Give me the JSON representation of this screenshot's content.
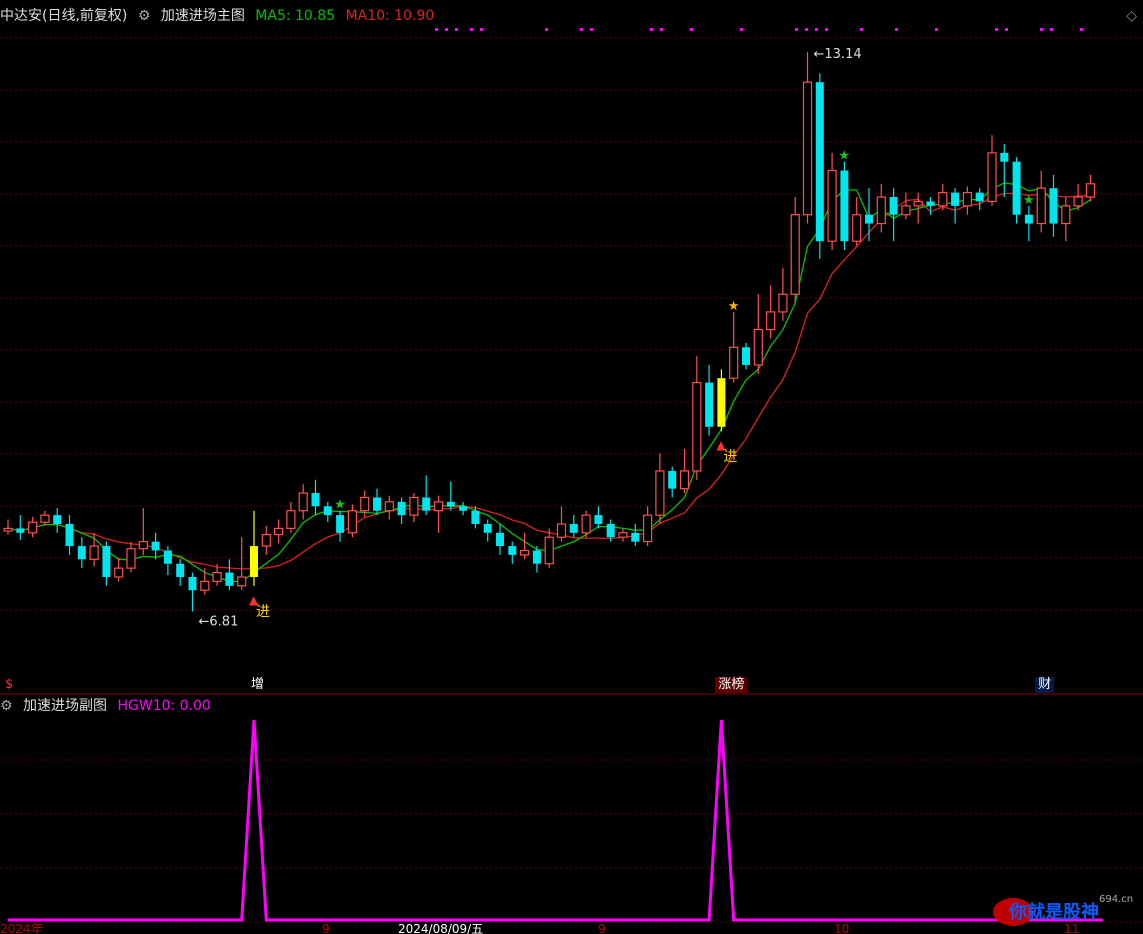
{
  "header": {
    "title": "中达安(日线,前复权)",
    "indicator": "加速进场主图",
    "ma5_label": "MA5: 10.85",
    "ma10_label": "MA10: 10.90",
    "settings_icon": "gear-circle-icon",
    "corner_icon": "diamond-icon"
  },
  "sub_header": {
    "indicator": "加速进场副图",
    "value_label": "HGW10: 0.00"
  },
  "colors": {
    "up": "#ff4f4f",
    "down": "#00e5ee",
    "ma5": "#00c000",
    "ma10": "#e02020",
    "signal": "#ff00ff",
    "highlight": "#ffff00",
    "grid": "#5a0000"
  },
  "event_tags": [
    {
      "index": 0,
      "text": "$"
    },
    {
      "index": 20,
      "text": "增"
    },
    {
      "index": 58,
      "text": "涨榜"
    },
    {
      "index": 84,
      "text": "财"
    }
  ],
  "annotations": {
    "low_label": "6.81",
    "high_label": "13.14",
    "entry_label": "进"
  },
  "x_axis": {
    "labels": [
      "2024年",
      "9",
      "2024/08/09/五",
      "9",
      "10",
      "11"
    ]
  },
  "watermark": {
    "text": "你就是股神",
    "site": "694.cn"
  },
  "chart_data": {
    "type": "candlestick",
    "title": "中达安(日线,前复权)",
    "min_price": 6.81,
    "max_price": 13.14,
    "candles": [
      [
        7.72,
        7.75,
        7.85,
        7.68
      ],
      [
        7.75,
        7.7,
        7.9,
        7.62
      ],
      [
        7.7,
        7.82,
        7.88,
        7.65
      ],
      [
        7.82,
        7.9,
        7.95,
        7.78
      ],
      [
        7.9,
        7.8,
        7.98,
        7.7
      ],
      [
        7.8,
        7.55,
        7.9,
        7.45
      ],
      [
        7.55,
        7.4,
        7.65,
        7.3
      ],
      [
        7.4,
        7.55,
        7.7,
        7.32
      ],
      [
        7.55,
        7.2,
        7.6,
        7.1
      ],
      [
        7.2,
        7.3,
        7.42,
        7.15
      ],
      [
        7.3,
        7.52,
        7.6,
        7.25
      ],
      [
        7.52,
        7.6,
        7.98,
        7.45
      ],
      [
        7.6,
        7.5,
        7.7,
        7.4
      ],
      [
        7.5,
        7.35,
        7.55,
        7.22
      ],
      [
        7.35,
        7.2,
        7.4,
        7.1
      ],
      [
        7.2,
        7.05,
        7.25,
        6.81
      ],
      [
        7.05,
        7.15,
        7.3,
        7.0
      ],
      [
        7.15,
        7.25,
        7.35,
        7.1
      ],
      [
        7.25,
        7.1,
        7.4,
        7.05
      ],
      [
        7.1,
        7.2,
        7.65,
        7.05
      ],
      [
        7.2,
        7.55,
        7.95,
        7.1
      ],
      [
        7.55,
        7.68,
        7.78,
        7.45
      ],
      [
        7.68,
        7.75,
        7.85,
        7.58
      ],
      [
        7.75,
        7.95,
        8.05,
        7.7
      ],
      [
        7.95,
        8.15,
        8.25,
        7.85
      ],
      [
        8.15,
        8.0,
        8.3,
        7.9
      ],
      [
        8.0,
        7.9,
        8.05,
        7.82
      ],
      [
        7.9,
        7.7,
        7.95,
        7.6
      ],
      [
        7.7,
        7.95,
        8.02,
        7.65
      ],
      [
        7.95,
        8.1,
        8.18,
        7.88
      ],
      [
        8.1,
        7.95,
        8.2,
        7.9
      ],
      [
        7.95,
        8.05,
        8.12,
        7.85
      ],
      [
        8.05,
        7.9,
        8.1,
        7.8
      ],
      [
        7.9,
        8.1,
        8.15,
        7.82
      ],
      [
        8.1,
        7.95,
        8.35,
        7.9
      ],
      [
        7.95,
        8.05,
        8.12,
        7.7
      ],
      [
        8.05,
        8.0,
        8.28,
        7.95
      ],
      [
        8.0,
        7.95,
        8.05,
        7.9
      ],
      [
        7.95,
        7.8,
        8.0,
        7.75
      ],
      [
        7.8,
        7.7,
        7.85,
        7.6
      ],
      [
        7.7,
        7.55,
        7.8,
        7.45
      ],
      [
        7.55,
        7.45,
        7.6,
        7.35
      ],
      [
        7.45,
        7.5,
        7.7,
        7.4
      ],
      [
        7.5,
        7.35,
        7.55,
        7.25
      ],
      [
        7.35,
        7.65,
        7.75,
        7.3
      ],
      [
        7.65,
        7.8,
        8.0,
        7.6
      ],
      [
        7.8,
        7.7,
        7.9,
        7.65
      ],
      [
        7.7,
        7.9,
        7.95,
        7.65
      ],
      [
        7.9,
        7.8,
        8.0,
        7.75
      ],
      [
        7.8,
        7.65,
        7.85,
        7.6
      ],
      [
        7.65,
        7.7,
        7.75,
        7.6
      ],
      [
        7.7,
        7.6,
        7.8,
        7.55
      ],
      [
        7.6,
        7.9,
        8.0,
        7.55
      ],
      [
        7.9,
        8.4,
        8.6,
        7.8
      ],
      [
        8.4,
        8.2,
        8.45,
        8.1
      ],
      [
        8.2,
        8.4,
        8.65,
        8.15
      ],
      [
        8.4,
        9.4,
        9.7,
        8.3
      ],
      [
        9.4,
        8.9,
        9.6,
        8.8
      ],
      [
        8.9,
        9.45,
        9.55,
        8.85
      ],
      [
        9.45,
        9.8,
        10.2,
        9.4
      ],
      [
        9.8,
        9.6,
        9.85,
        9.55
      ],
      [
        9.6,
        10.0,
        10.4,
        9.5
      ],
      [
        10.0,
        10.2,
        10.5,
        9.9
      ],
      [
        10.2,
        10.4,
        10.7,
        10.1
      ],
      [
        10.4,
        11.3,
        11.5,
        10.3
      ],
      [
        11.3,
        12.8,
        13.14,
        11.2
      ],
      [
        12.8,
        11.0,
        12.9,
        10.8
      ],
      [
        11.0,
        11.8,
        12.0,
        10.9
      ],
      [
        11.8,
        11.0,
        11.9,
        10.9
      ],
      [
        11.0,
        11.3,
        11.5,
        10.95
      ],
      [
        11.3,
        11.2,
        11.6,
        11.0
      ],
      [
        11.2,
        11.5,
        11.65,
        11.1
      ],
      [
        11.5,
        11.3,
        11.6,
        11.0
      ],
      [
        11.3,
        11.4,
        11.55,
        11.25
      ],
      [
        11.4,
        11.45,
        11.55,
        11.2
      ],
      [
        11.45,
        11.4,
        11.5,
        11.3
      ],
      [
        11.4,
        11.55,
        11.65,
        11.35
      ],
      [
        11.55,
        11.4,
        11.6,
        11.2
      ],
      [
        11.4,
        11.55,
        11.62,
        11.3
      ],
      [
        11.55,
        11.45,
        11.6,
        11.35
      ],
      [
        11.45,
        12.0,
        12.2,
        11.4
      ],
      [
        12.0,
        11.9,
        12.1,
        11.5
      ],
      [
        11.9,
        11.3,
        11.95,
        11.2
      ],
      [
        11.3,
        11.2,
        11.4,
        11.0
      ],
      [
        11.2,
        11.6,
        11.8,
        11.1
      ],
      [
        11.6,
        11.2,
        11.75,
        11.05
      ],
      [
        11.2,
        11.4,
        11.5,
        11.0
      ],
      [
        11.4,
        11.5,
        11.65,
        11.35
      ],
      [
        11.5,
        11.65,
        11.75,
        11.45
      ]
    ],
    "highlight_index": [
      20,
      58
    ],
    "hgw10_series": [
      0,
      0,
      0,
      0,
      0,
      0,
      0,
      0,
      0,
      0,
      0,
      0,
      0,
      0,
      0,
      0,
      0,
      0,
      0,
      0,
      1,
      0,
      0,
      0,
      0,
      0,
      0,
      0,
      0,
      0,
      0,
      0,
      0,
      0,
      0,
      0,
      0,
      0,
      0,
      0,
      0,
      0,
      0,
      0,
      0,
      0,
      0,
      0,
      0,
      0,
      0,
      0,
      0,
      0,
      0,
      0,
      0,
      0,
      1,
      0,
      0,
      0,
      0,
      0,
      0,
      0,
      0,
      0,
      0,
      0,
      0,
      0,
      0,
      0,
      0,
      0,
      0,
      0,
      0,
      0,
      0,
      0,
      0,
      0,
      0,
      0,
      0,
      0,
      0,
      0
    ]
  }
}
